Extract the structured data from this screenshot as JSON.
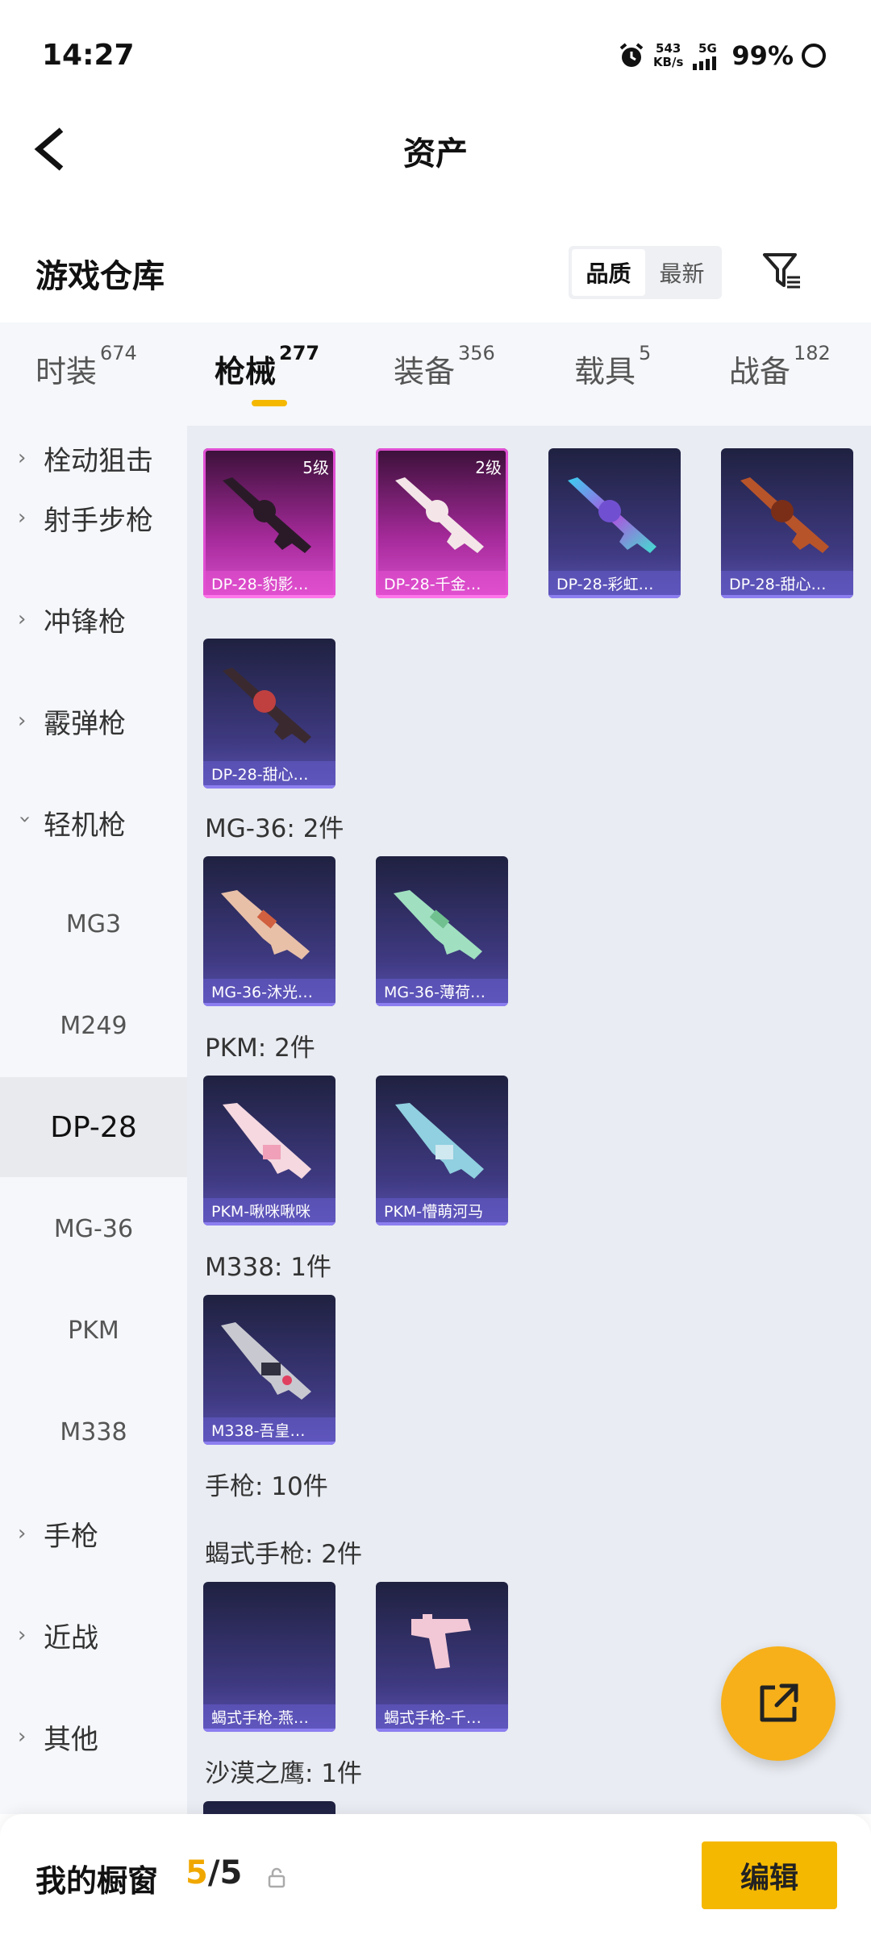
{
  "status_bar": {
    "time": "14:27",
    "net_speed": "543",
    "net_unit": "KB/s",
    "network": "5G",
    "battery": "99%"
  },
  "header": {
    "title": "资产"
  },
  "warehouse": {
    "title": "游戏仓库",
    "sort_options": [
      "品质",
      "最新"
    ],
    "sort_selected": "品质"
  },
  "tabs": [
    {
      "label": "时装",
      "count": "674"
    },
    {
      "label": "枪械",
      "count": "277",
      "active": true
    },
    {
      "label": "装备",
      "count": "356"
    },
    {
      "label": "载具",
      "count": "5"
    },
    {
      "label": "战备",
      "count": "182"
    }
  ],
  "sidebar": {
    "items": [
      {
        "label": "栓动狙击"
      },
      {
        "label": "射手步枪"
      },
      {
        "label": "冲锋枪"
      },
      {
        "label": "霰弹枪"
      },
      {
        "label": "轻机枪",
        "expanded": true
      }
    ],
    "subitems": [
      {
        "label": "MG3"
      },
      {
        "label": "M249"
      },
      {
        "label": "DP-28",
        "selected": true
      },
      {
        "label": "MG-36"
      },
      {
        "label": "PKM"
      },
      {
        "label": "M338"
      }
    ],
    "after": [
      {
        "label": "手枪"
      },
      {
        "label": "近战"
      },
      {
        "label": "其他"
      }
    ]
  },
  "content": {
    "dp28_items": [
      {
        "name": "DP-28-豹影…",
        "level": "5级",
        "rarity": "legendary"
      },
      {
        "name": "DP-28-千金…",
        "level": "2级",
        "rarity": "legendary"
      },
      {
        "name": "DP-28-彩虹…",
        "rarity": "epic"
      },
      {
        "name": "DP-28-甜心…",
        "rarity": "epic"
      },
      {
        "name": "DP-28-甜心…",
        "rarity": "epic"
      }
    ],
    "groups": [
      {
        "title": "MG-36: 2件",
        "items": [
          {
            "name": "MG-36-沐光…"
          },
          {
            "name": "MG-36-薄荷…"
          }
        ]
      },
      {
        "title": "PKM: 2件",
        "items": [
          {
            "name": "PKM-啾咪啾咪"
          },
          {
            "name": "PKM-懵萌河马"
          }
        ]
      },
      {
        "title": "M338: 1件",
        "items": [
          {
            "name": "M338-吾皇…"
          }
        ]
      },
      {
        "title": "手枪: 10件",
        "items": []
      },
      {
        "title": "蝎式手枪: 2件",
        "items": [
          {
            "name": "蝎式手枪-燕…"
          },
          {
            "name": "蝎式手枪-千…"
          }
        ]
      },
      {
        "title": "沙漠之鹰: 1件",
        "items": []
      }
    ]
  },
  "bottom_bar": {
    "label": "我的橱窗",
    "count_current": "5",
    "count_total": "/5",
    "edit_label": "编辑"
  },
  "colors": {
    "accent": "#f5b800",
    "legendary": "#d94fcc",
    "epic": "#5a52b0",
    "fab": "#f7b01a"
  }
}
